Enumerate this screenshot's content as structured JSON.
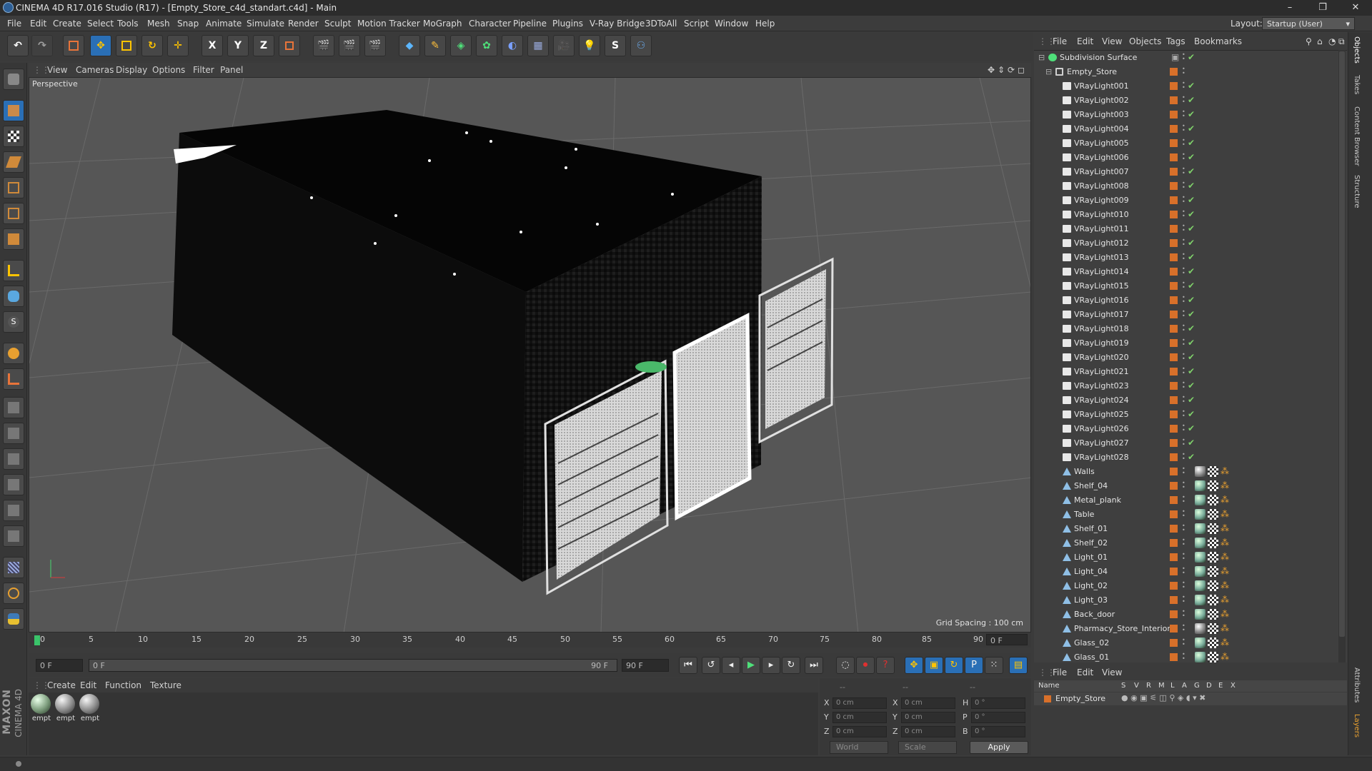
{
  "window": {
    "title": "CINEMA 4D R17.016 Studio (R17) - [Empty_Store_c4d_standart.c4d] - Main",
    "controls": [
      "–",
      "❐",
      "✕"
    ]
  },
  "menu": [
    "File",
    "Edit",
    "Create",
    "Select",
    "Tools",
    "Mesh",
    "Snap",
    "Animate",
    "Simulate",
    "Render",
    "Sculpt",
    "Motion Tracker",
    "MoGraph",
    "Character",
    "Pipeline",
    "Plugins",
    "V-Ray Bridge",
    "3DToAll",
    "Script",
    "Window",
    "Help"
  ],
  "layout": {
    "label": "Layout:",
    "value": "Startup (User)"
  },
  "toolbar": {
    "axis_x": "X",
    "axis_y": "Y",
    "axis_z": "Z"
  },
  "viewport": {
    "menu": [
      "View",
      "Cameras",
      "Display",
      "Options",
      "Filter",
      "Panel"
    ],
    "label": "Perspective",
    "grid_spacing": "Grid Spacing : 100 cm"
  },
  "timeline": {
    "ticks": [
      "0",
      "5",
      "10",
      "15",
      "20",
      "25",
      "30",
      "35",
      "40",
      "45",
      "50",
      "55",
      "60",
      "65",
      "70",
      "75",
      "80",
      "85",
      "90"
    ],
    "frame_field": "0 F",
    "start": "0 F",
    "slider_start": "0 F",
    "slider_end": "90 F",
    "end": "90 F"
  },
  "materials": {
    "menu": [
      "Create",
      "Edit",
      "Function",
      "Texture"
    ],
    "items": [
      {
        "label": "empt"
      },
      {
        "label": "empt"
      },
      {
        "label": "empt"
      }
    ]
  },
  "coordinates": {
    "header_dashes": [
      "--",
      "--",
      "--"
    ],
    "rows": [
      {
        "a": "X",
        "av": "0 cm",
        "b": "X",
        "bv": "0 cm",
        "c": "H",
        "cv": "0 °"
      },
      {
        "a": "Y",
        "av": "0 cm",
        "b": "Y",
        "bv": "0 cm",
        "c": "P",
        "cv": "0 °"
      },
      {
        "a": "Z",
        "av": "0 cm",
        "b": "Z",
        "bv": "0 cm",
        "c": "B",
        "cv": "0 °"
      }
    ],
    "world": "World",
    "scale": "Scale",
    "apply": "Apply"
  },
  "object_manager": {
    "menu": [
      "File",
      "Edit",
      "View",
      "Objects",
      "Tags",
      "Bookmarks"
    ],
    "objects": [
      {
        "name": "Subdivision Surface",
        "type": "sds",
        "indent": 0
      },
      {
        "name": "Empty_Store",
        "type": "null",
        "indent": 1
      },
      {
        "name": "VRayLight001",
        "type": "light",
        "indent": 2
      },
      {
        "name": "VRayLight002",
        "type": "light",
        "indent": 2
      },
      {
        "name": "VRayLight003",
        "type": "light",
        "indent": 2
      },
      {
        "name": "VRayLight004",
        "type": "light",
        "indent": 2
      },
      {
        "name": "VRayLight005",
        "type": "light",
        "indent": 2
      },
      {
        "name": "VRayLight006",
        "type": "light",
        "indent": 2
      },
      {
        "name": "VRayLight007",
        "type": "light",
        "indent": 2
      },
      {
        "name": "VRayLight008",
        "type": "light",
        "indent": 2
      },
      {
        "name": "VRayLight009",
        "type": "light",
        "indent": 2
      },
      {
        "name": "VRayLight010",
        "type": "light",
        "indent": 2
      },
      {
        "name": "VRayLight011",
        "type": "light",
        "indent": 2
      },
      {
        "name": "VRayLight012",
        "type": "light",
        "indent": 2
      },
      {
        "name": "VRayLight013",
        "type": "light",
        "indent": 2
      },
      {
        "name": "VRayLight014",
        "type": "light",
        "indent": 2
      },
      {
        "name": "VRayLight015",
        "type": "light",
        "indent": 2
      },
      {
        "name": "VRayLight016",
        "type": "light",
        "indent": 2
      },
      {
        "name": "VRayLight017",
        "type": "light",
        "indent": 2
      },
      {
        "name": "VRayLight018",
        "type": "light",
        "indent": 2
      },
      {
        "name": "VRayLight019",
        "type": "light",
        "indent": 2
      },
      {
        "name": "VRayLight020",
        "type": "light",
        "indent": 2
      },
      {
        "name": "VRayLight021",
        "type": "light",
        "indent": 2
      },
      {
        "name": "VRayLight023",
        "type": "light",
        "indent": 2
      },
      {
        "name": "VRayLight024",
        "type": "light",
        "indent": 2
      },
      {
        "name": "VRayLight025",
        "type": "light",
        "indent": 2
      },
      {
        "name": "VRayLight026",
        "type": "light",
        "indent": 2
      },
      {
        "name": "VRayLight027",
        "type": "light",
        "indent": 2
      },
      {
        "name": "VRayLight028",
        "type": "light",
        "indent": 2
      },
      {
        "name": "Walls",
        "type": "poly",
        "indent": 2,
        "mat": "ball"
      },
      {
        "name": "Shelf_04",
        "type": "poly",
        "indent": 2,
        "mat": "ballg"
      },
      {
        "name": "Metal_plank",
        "type": "poly",
        "indent": 2,
        "mat": "ballg"
      },
      {
        "name": "Table",
        "type": "poly",
        "indent": 2,
        "mat": "ballg"
      },
      {
        "name": "Shelf_01",
        "type": "poly",
        "indent": 2,
        "mat": "ballg"
      },
      {
        "name": "Shelf_02",
        "type": "poly",
        "indent": 2,
        "mat": "ballg"
      },
      {
        "name": "Light_01",
        "type": "poly",
        "indent": 2,
        "mat": "ballg"
      },
      {
        "name": "Light_04",
        "type": "poly",
        "indent": 2,
        "mat": "ballg"
      },
      {
        "name": "Light_02",
        "type": "poly",
        "indent": 2,
        "mat": "ballg"
      },
      {
        "name": "Light_03",
        "type": "poly",
        "indent": 2,
        "mat": "ballg"
      },
      {
        "name": "Back_door",
        "type": "poly",
        "indent": 2,
        "mat": "ballg"
      },
      {
        "name": "Pharmacy_Store_Interior",
        "type": "poly",
        "indent": 2,
        "mat": "ball"
      },
      {
        "name": "Glass_02",
        "type": "poly",
        "indent": 2,
        "mat": "ballg"
      },
      {
        "name": "Glass_01",
        "type": "poly",
        "indent": 2,
        "mat": "ballg"
      }
    ]
  },
  "layer_manager": {
    "menu": [
      "File",
      "Edit",
      "View"
    ],
    "columns": [
      "Name",
      "S",
      "V",
      "R",
      "M",
      "L",
      "A",
      "G",
      "D",
      "E",
      "X"
    ],
    "row": "Empty_Store"
  },
  "side_tabs": [
    "Objects",
    "Takes",
    "Content Browser",
    "Structure",
    "Attributes",
    "Layers"
  ],
  "brand": [
    "MAXON",
    "CINEMA 4D"
  ],
  "colors": {
    "accent": "#2a6fb6",
    "layer_orange": "#d8702a",
    "check": "#7fd06a"
  }
}
